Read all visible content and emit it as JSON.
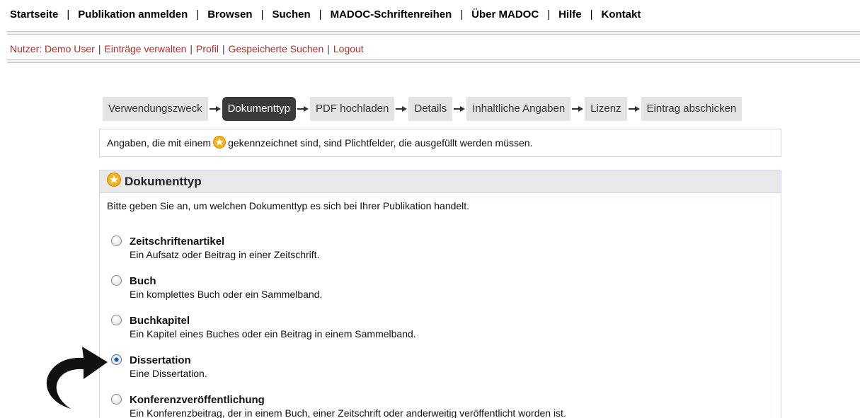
{
  "topnav": {
    "items": [
      "Startseite",
      "Publikation anmelden",
      "Browsen",
      "Suchen",
      "MADOC-Schriftenreihen",
      "Über MADOC",
      "Hilfe",
      "Kontakt"
    ]
  },
  "usernav": {
    "user": "Nutzer: Demo User",
    "items": [
      "Einträge verwalten",
      "Profil",
      "Gespeicherte Suchen",
      "Logout"
    ]
  },
  "steps": {
    "items": [
      "Verwendungszweck",
      "Dokumenttyp",
      "PDF hochladen",
      "Details",
      "Inhaltliche Angaben",
      "Lizenz",
      "Eintrag abschicken"
    ],
    "active": "Dokumenttyp"
  },
  "notice": {
    "before": "Angaben, die mit einem",
    "after": "gekennzeichnet sind, sind Plichtfelder, die ausgefüllt werden müssen."
  },
  "section": {
    "title": "Dokumenttyp",
    "intro": "Bitte geben Sie an, um welchen Dokumenttyp es sich bei Ihrer Publikation handelt.",
    "options": [
      {
        "title": "Zeitschriftenartikel",
        "desc": "Ein Aufsatz oder Beitrag in einer Zeitschrift.",
        "selected": false
      },
      {
        "title": "Buch",
        "desc": "Ein komplettes Buch oder ein Sammelband.",
        "selected": false
      },
      {
        "title": "Buchkapitel",
        "desc": "Ein Kapitel eines Buches oder ein Beitrag in einem Sammelband.",
        "selected": false
      },
      {
        "title": "Dissertation",
        "desc": "Eine Dissertation.",
        "selected": true
      },
      {
        "title": "Konferenzveröffentlichung",
        "desc": "Ein Konferenzbeitrag, der in einem Buch, einer Zeitschrift oder anderweitig veröffentlicht worden ist.",
        "selected": false
      }
    ]
  },
  "colors": {
    "user_link": "#b8292a",
    "active_step": "#3b3b3b",
    "step_bg": "#e4e4e4",
    "required_star": "#f5b21a"
  }
}
